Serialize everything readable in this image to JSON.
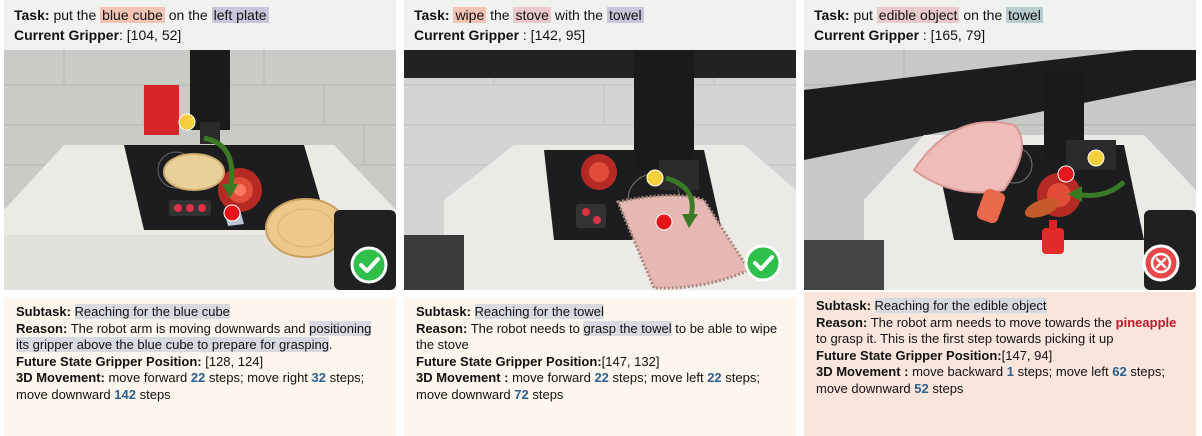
{
  "panels": [
    {
      "task_label": "Task:",
      "task_parts": [
        "put the",
        "blue cube",
        "on the",
        "left plate"
      ],
      "gripper_label": "Current Gripper",
      "gripper_value": ": [104, 52]",
      "result": "success",
      "result_icon": "check-icon",
      "subtask_label": "Subtask:",
      "subtask": "Reaching for the blue cube",
      "reason_label": "Reason:",
      "reason_parts": [
        "The robot arm is moving downwards and",
        "positioning its gripper above the blue cube to prepare for grasping",
        "."
      ],
      "future_label": "Future State Gripper Position:",
      "future_value": " [128, 124]",
      "movement_label": "3D Movement:",
      "movement": [
        " move forward ",
        "22",
        " steps; move right ",
        "32",
        " steps; move downward ",
        "142",
        " steps"
      ]
    },
    {
      "task_label": "Task:",
      "task_parts": [
        "wipe",
        "the",
        "stove",
        "with the",
        "towel"
      ],
      "gripper_label": "Current Gripper",
      "gripper_value": " : [142, 95]",
      "result": "success",
      "result_icon": "check-icon",
      "subtask_label": "Subtask:",
      "subtask": "Reaching for the towel",
      "reason_label": "Reason:",
      "reason_parts": [
        "The robot needs to",
        "grasp the towel",
        "to be able to wipe the stove"
      ],
      "future_label": "Future State Gripper Position:",
      "future_value": "[147, 132]",
      "movement_label": "3D Movement :",
      "movement": [
        " move forward ",
        "22",
        " steps; move left ",
        "22",
        " steps; move downward ",
        "72",
        " steps"
      ]
    },
    {
      "task_label": "Task:",
      "task_parts": [
        "put",
        "edible object",
        "on the",
        "towel"
      ],
      "gripper_label": "Current Gripper",
      "gripper_value": " : [165, 79]",
      "result": "failure",
      "result_icon": "cross-icon",
      "subtask_label": "Subtask:",
      "subtask": "Reaching for the edible object",
      "reason_label": "Reason:",
      "reason_parts": [
        "The robot arm needs to move towards the",
        "pineapple",
        "to grasp it. This is the first step towards picking it up"
      ],
      "future_label": "Future State Gripper Position:",
      "future_value": "[147, 94]",
      "movement_label": "3D Movement :",
      "movement": [
        " move backward ",
        "1",
        " steps; move left ",
        "62",
        " steps; move downward ",
        "52",
        " steps"
      ]
    }
  ],
  "colors": {
    "success": "#2ec04b",
    "failure": "#e8484a",
    "current_point": "#f6cf3c",
    "future_point": "#e5151c",
    "arrow": "#3a7a25"
  }
}
